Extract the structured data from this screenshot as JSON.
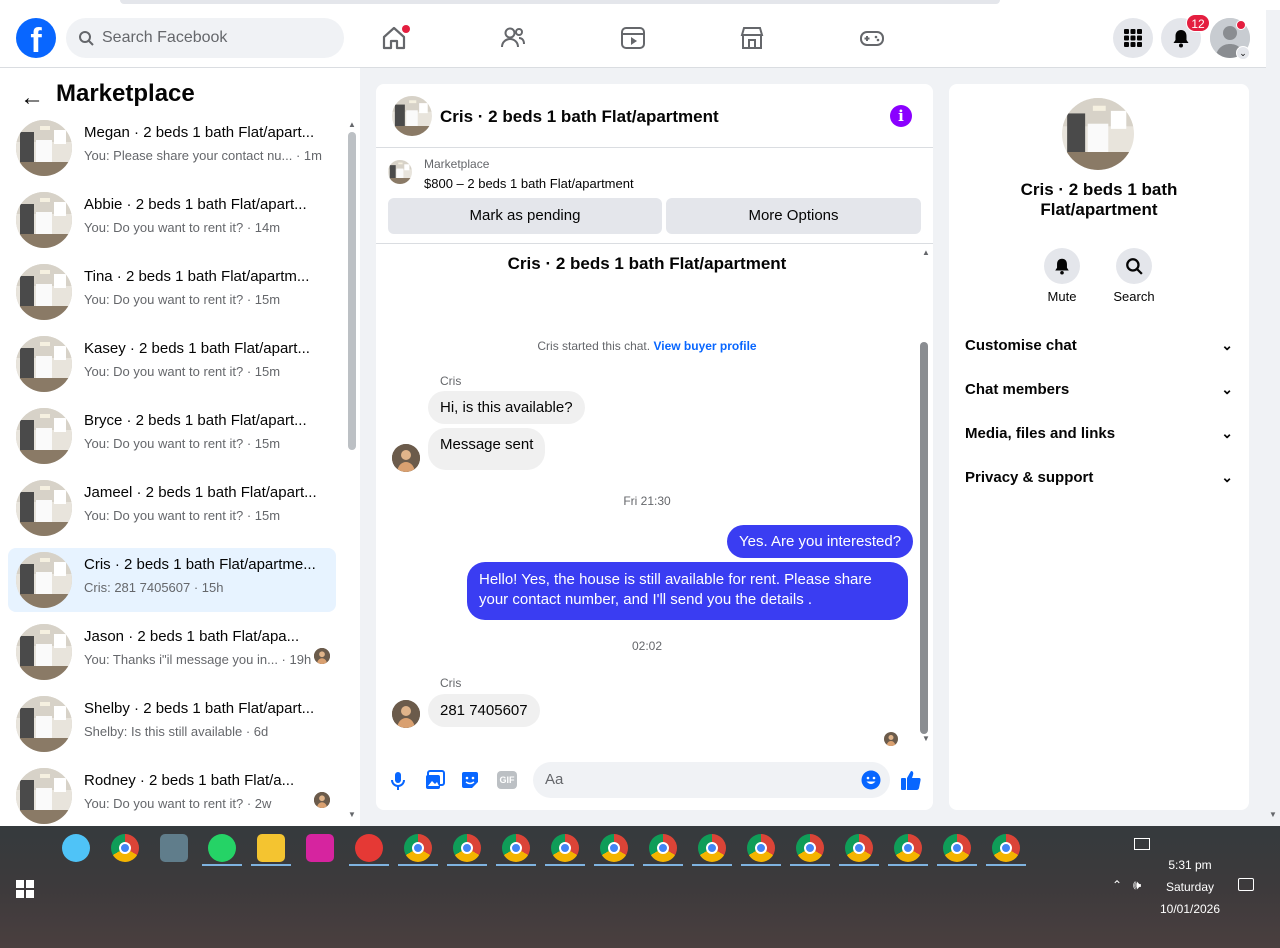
{
  "topbar": {
    "search_placeholder": "Search Facebook",
    "notifications_badge": "12",
    "icons": [
      "facebook-logo",
      "search-icon",
      "home-icon",
      "friends-icon",
      "watch-icon",
      "marketplace-icon",
      "gaming-icon",
      "menu-grid-icon",
      "bell-icon",
      "account-avatar"
    ]
  },
  "sidebar": {
    "title": "Marketplace",
    "conversations": [
      {
        "name": "Megan · 2 beds 1 bath Flat/apart...",
        "preview": "You: Please share your contact nu... · 1m",
        "selected": false
      },
      {
        "name": "Abbie · 2 beds 1 bath Flat/apart...",
        "preview": "You: Do you want to rent it? · 14m",
        "selected": false
      },
      {
        "name": "Tina · 2 beds 1 bath Flat/apartm...",
        "preview": "You: Do you want to rent it? · 15m",
        "selected": false
      },
      {
        "name": "Kasey · 2 beds 1 bath Flat/apart...",
        "preview": "You: Do you want to rent it? · 15m",
        "selected": false
      },
      {
        "name": "Bryce · 2 beds 1 bath Flat/apart...",
        "preview": "You: Do you want to rent it? · 15m",
        "selected": false
      },
      {
        "name": "Jameel · 2 beds 1 bath Flat/apart...",
        "preview": "You: Do you want to rent it? · 15m",
        "selected": false
      },
      {
        "name": "Cris · 2 beds 1 bath Flat/apartme...",
        "preview": "Cris: 281 7405607 · 15h",
        "selected": true
      },
      {
        "name": "Jason · 2 beds 1 bath Flat/apa...",
        "preview": "You: Thanks i\"il message you in... · 19h",
        "selected": false
      },
      {
        "name": "Shelby · 2 beds 1 bath Flat/apart...",
        "preview": "Shelby: Is this still available · 6d",
        "selected": false
      },
      {
        "name": "Rodney · 2 beds 1 bath Flat/a...",
        "preview": "You: Do you want to rent it? · 2w",
        "selected": false
      }
    ]
  },
  "chat": {
    "title": "Cris · 2 beds 1 bath Flat/apartment",
    "listing_category": "Marketplace",
    "listing_price_title": "$800 – 2 beds 1 bath Flat/apartment",
    "mark_pending_label": "Mark as pending",
    "more_options_label": "More Options",
    "pane_title": "Cris · 2 beds 1 bath Flat/apartment",
    "started_text": "Cris started this chat.",
    "view_buyer_profile": "View buyer profile",
    "sender_1": "Cris",
    "msg_in_1": "Hi, is this available?",
    "msg_in_2": "Message sent",
    "timestamp_1": "Fri 21:30",
    "msg_out_1": "Yes. Are you interested?",
    "msg_out_2": "Hello! Yes, the house is still available for rent. Please share your contact number, and I'll send you the details .",
    "timestamp_2": "02:02",
    "sender_2": "Cris",
    "msg_in_3": "281 7405607",
    "composer_placeholder": "Aa"
  },
  "details": {
    "title": "Cris · 2 beds 1 bath Flat/apartment",
    "mute_label": "Mute",
    "search_label": "Search",
    "sections": [
      "Customise chat",
      "Chat members",
      "Media, files and links",
      "Privacy & support"
    ]
  },
  "taskbar": {
    "time": "5:31 pm",
    "day": "Saturday",
    "date": "10/01/2026"
  },
  "colors": {
    "brand": "#0866ff",
    "outgoing_bubble": "#3a3df2",
    "selected_row": "#e7f3ff",
    "info_icon": "#8a00ff",
    "badge": "#e41e3f"
  }
}
